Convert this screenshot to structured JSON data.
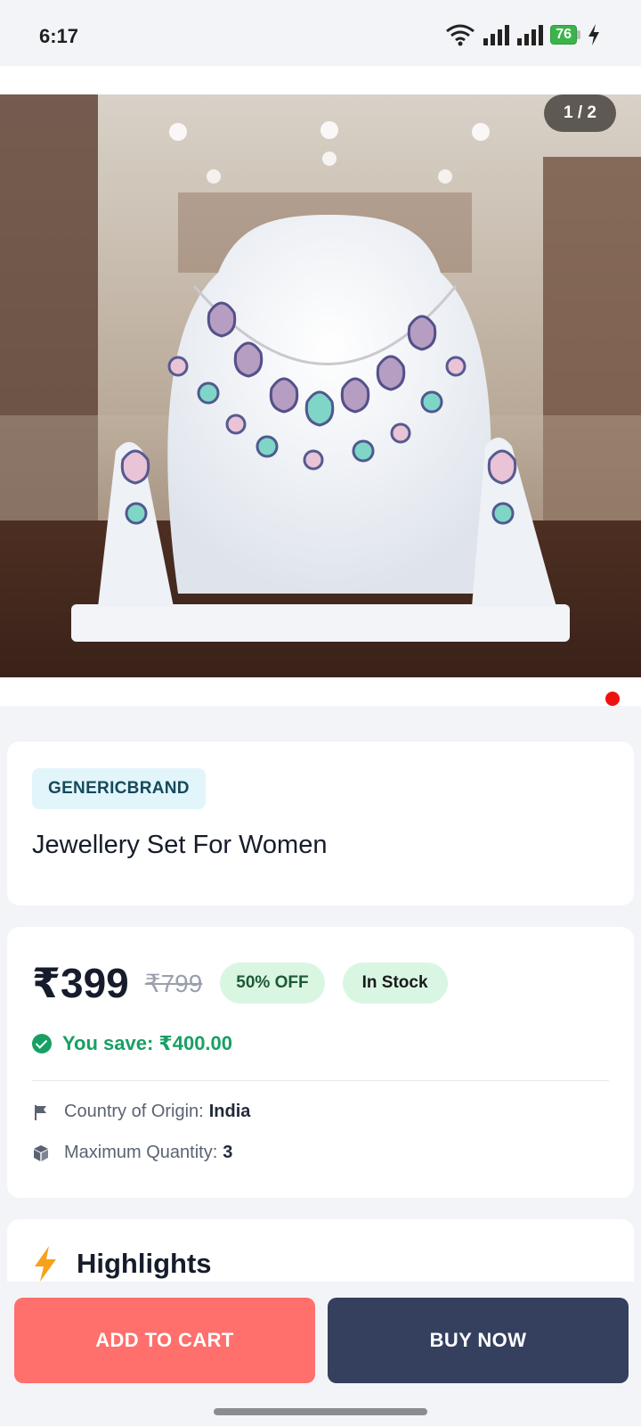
{
  "status": {
    "time": "6:17",
    "battery": "76"
  },
  "gallery": {
    "counter": "1 / 2"
  },
  "product": {
    "brand": "GENERICBRAND",
    "name": "Jewellery Set For Women"
  },
  "pricing": {
    "price": "₹399",
    "mrp": "₹799",
    "discount": "50% OFF",
    "stock": "In Stock",
    "savings": "You save: ₹400.00"
  },
  "meta": {
    "origin_label": "Country of Origin:",
    "origin_value": "India",
    "qty_label": "Maximum Quantity:",
    "qty_value": "3"
  },
  "highlights": {
    "title": "Highlights"
  },
  "actions": {
    "add_to_cart": "ADD TO CART",
    "buy_now": "BUY NOW"
  },
  "colors": {
    "accent_cart": "#ff6f6b",
    "accent_buy": "#34405e",
    "success": "#17a063"
  }
}
